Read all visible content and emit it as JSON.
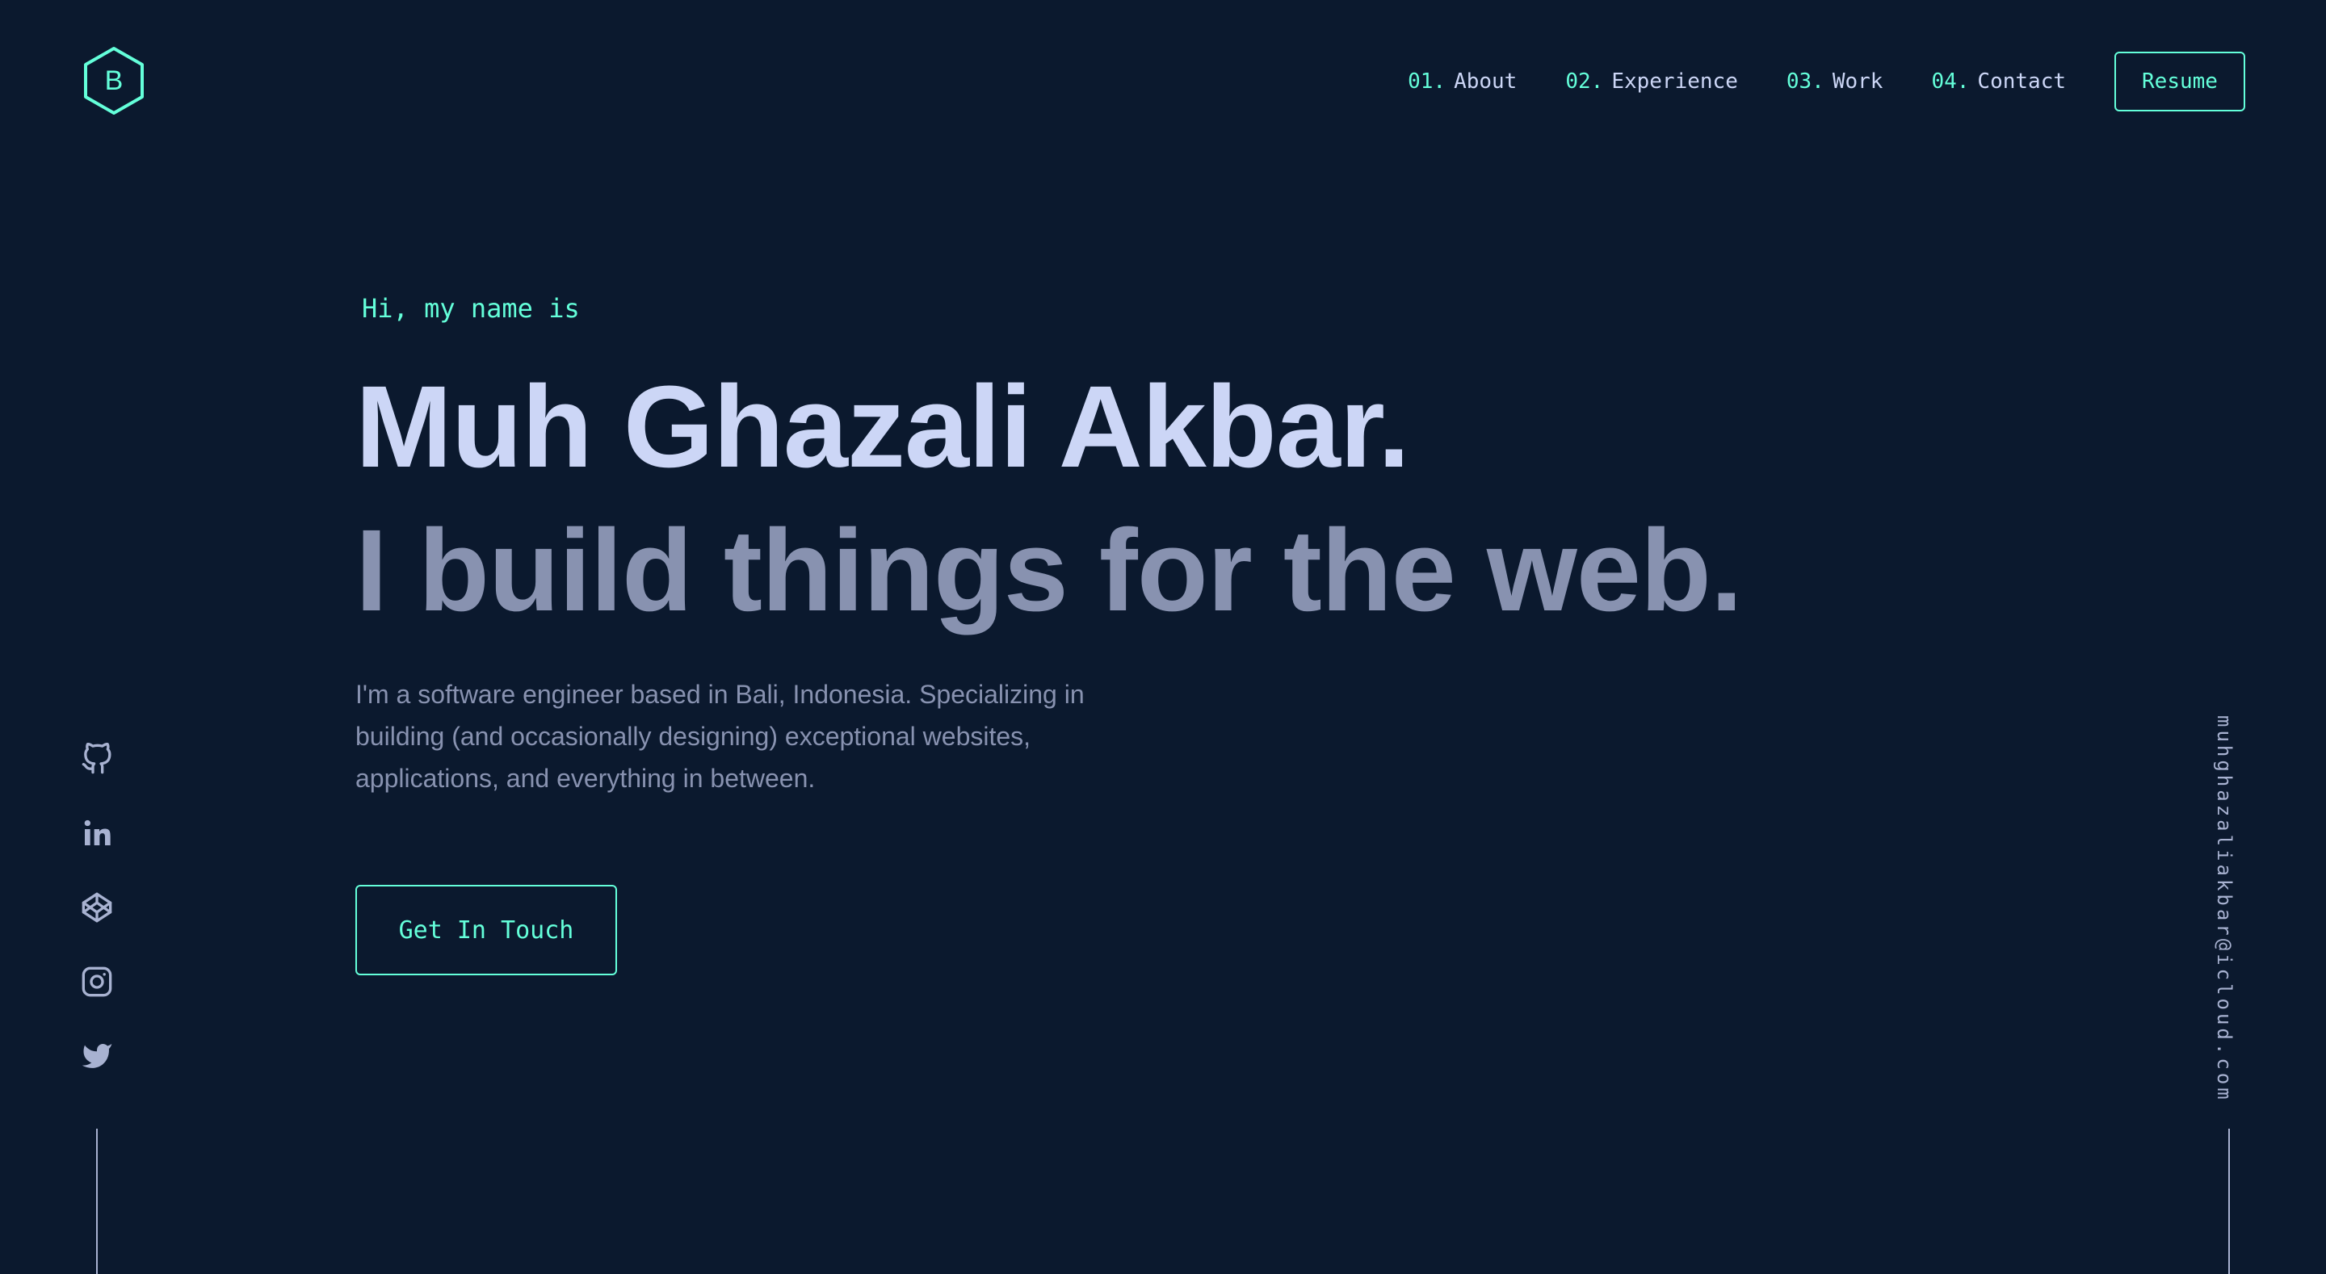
{
  "logo": {
    "letter": "B"
  },
  "nav": {
    "items": [
      {
        "num": "01.",
        "label": "About"
      },
      {
        "num": "02.",
        "label": "Experience"
      },
      {
        "num": "03.",
        "label": "Work"
      },
      {
        "num": "04.",
        "label": "Contact"
      }
    ],
    "resume_label": "Resume"
  },
  "hero": {
    "greeting": "Hi, my name is",
    "name": "Muh Ghazali Akbar.",
    "tagline": "I build things for the web.",
    "description": "I'm a software engineer based in Bali, Indonesia. Specializing in building (and occasionally designing) exceptional websites, applications, and everything in between.",
    "cta_label": "Get In Touch"
  },
  "social": [
    "github-icon",
    "linkedin-icon",
    "codepen-icon",
    "instagram-icon",
    "twitter-icon"
  ],
  "email": "muhghazaliakbar@icloud.com",
  "colors": {
    "background": "#0b192e",
    "accent": "#64ffda",
    "heading": "#ccd6f6",
    "muted": "#8892b0"
  }
}
